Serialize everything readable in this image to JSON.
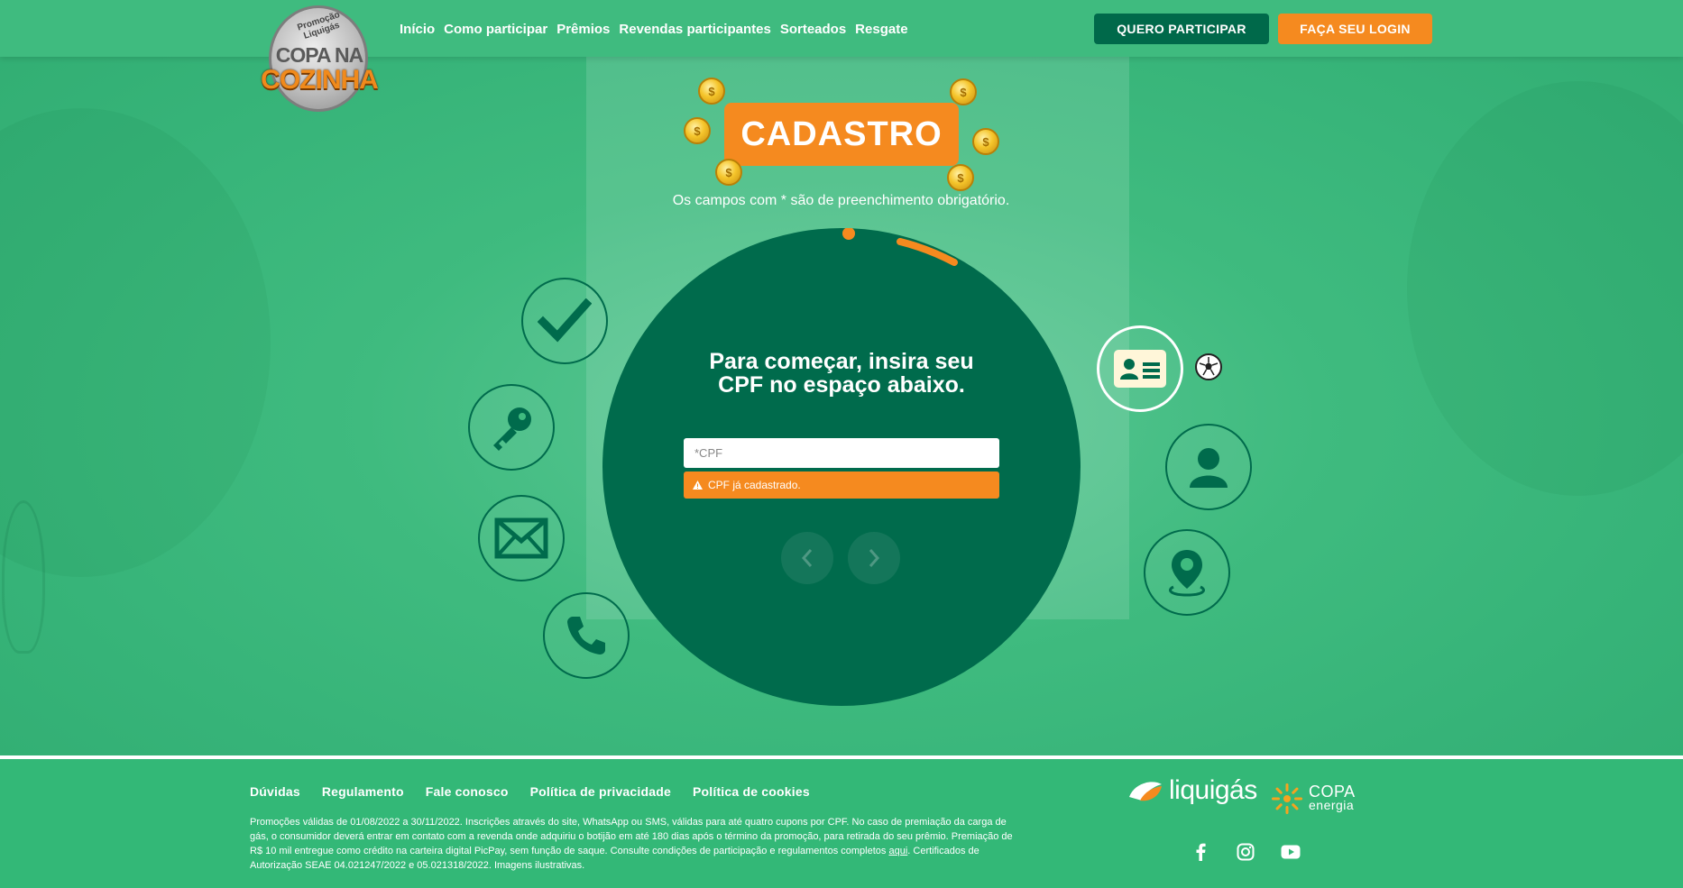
{
  "header": {
    "logo": {
      "promo_text": "Promoção Liquigás",
      "line1": "COPA NA",
      "line2": "COZINHA"
    },
    "nav": [
      "Início",
      "Como participar",
      "Prêmios",
      "Revendas participantes",
      "Sorteados",
      "Resgate"
    ],
    "participate_label": "QUERO PARTICIPAR",
    "login_label": "FAÇA SEU LOGIN"
  },
  "form": {
    "title": "CADASTRO",
    "required_note": "Os campos com * são de preenchimento obrigatório.",
    "prompt": "Para começar, insira seu CPF no espaço abaixo.",
    "cpf_placeholder": "*CPF",
    "cpf_value": "",
    "error": "CPF já cadastrado.",
    "coin_symbol": "$"
  },
  "steps": [
    {
      "icon": "checkmark-icon"
    },
    {
      "icon": "key-icon"
    },
    {
      "icon": "envelope-icon"
    },
    {
      "icon": "phone-icon"
    },
    {
      "icon": "id-card-icon",
      "active": true
    },
    {
      "icon": "user-icon"
    },
    {
      "icon": "location-pin-icon"
    }
  ],
  "footer": {
    "links": [
      "Dúvidas",
      "Regulamento",
      "Fale conosco",
      "Política de privacidade",
      "Política de cookies"
    ],
    "legal_text": "Promoções válidas de 01/08/2022 a 30/11/2022. Inscrições através do site, WhatsApp ou SMS, válidas para até quatro cupons por CPF. No caso de premiação da carga de gás, o consumidor deverá entrar em contato com a revenda onde adquiriu o botijão em até 180 dias após o término da promoção, para retirada do seu prêmio. Premiação de R$ 10 mil entregue como crédito na carteira digital PicPay, sem função de saque. Consulte condições de participação e regulamentos completos ",
    "legal_link": "aqui",
    "legal_tail": ". Certificados de Autorização SEAE 04.021247/2022 e 05.021318/2022. Imagens ilustrativas.",
    "brand1": "liquigás",
    "brand2_line1": "COPA",
    "brand2_line2": "energia",
    "socials": [
      "facebook-icon",
      "instagram-icon",
      "youtube-icon"
    ]
  },
  "colors": {
    "background_green": "#33b877",
    "dark_green": "#006b4c",
    "orange": "#f58a1f"
  }
}
